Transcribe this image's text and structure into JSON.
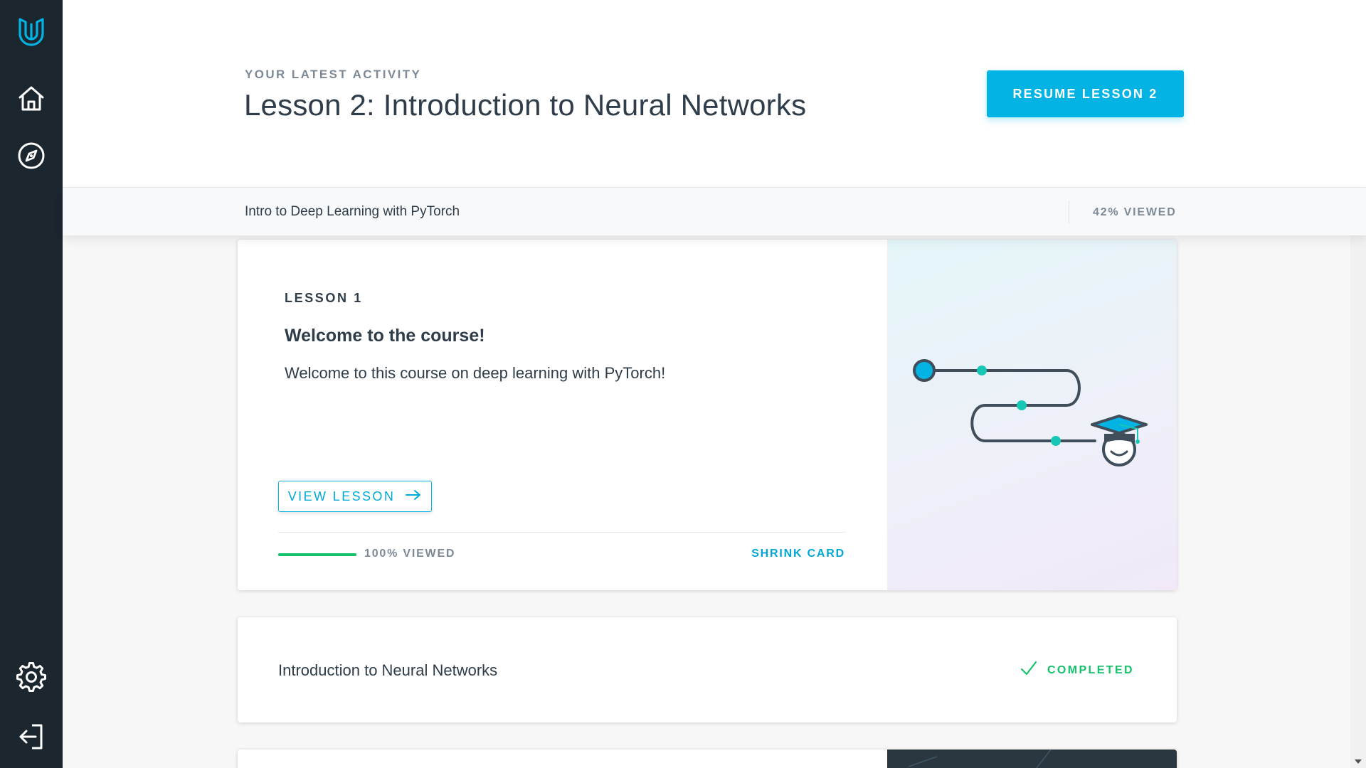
{
  "sidebar": {
    "logo_icon": "udacity-logo-icon",
    "items": [
      {
        "icon": "home-icon"
      },
      {
        "icon": "compass-icon"
      }
    ],
    "bottom_items": [
      {
        "icon": "gear-icon"
      },
      {
        "icon": "logout-icon"
      }
    ]
  },
  "header": {
    "eyebrow": "YOUR LATEST ACTIVITY",
    "title": "Lesson 2: Introduction to Neural Networks",
    "resume_label": "RESUME LESSON 2"
  },
  "course": {
    "name": "Intro to Deep Learning with PyTorch",
    "progress_label": "42% VIEWED",
    "progress_fraction": 0.42
  },
  "lesson_card": {
    "label": "LESSON 1",
    "title": "Welcome to the course!",
    "description": "Welcome to this course on deep learning with PyTorch!",
    "view_label": "VIEW LESSON",
    "progress_fraction": 1.0,
    "progress_label": "100% VIEWED",
    "shrink_label": "SHRINK CARD",
    "illustration_icon": "learning-path-graduate-icon"
  },
  "lesson_row": {
    "title": "Introduction to Neural Networks",
    "status": "COMPLETED",
    "status_icon": "checkmark-icon"
  },
  "colors": {
    "sidebar_bg": "#1c262f",
    "accent": "#02b3e4",
    "success": "#15c26b",
    "text": "#2e3d49",
    "muted": "#7d8a96"
  }
}
